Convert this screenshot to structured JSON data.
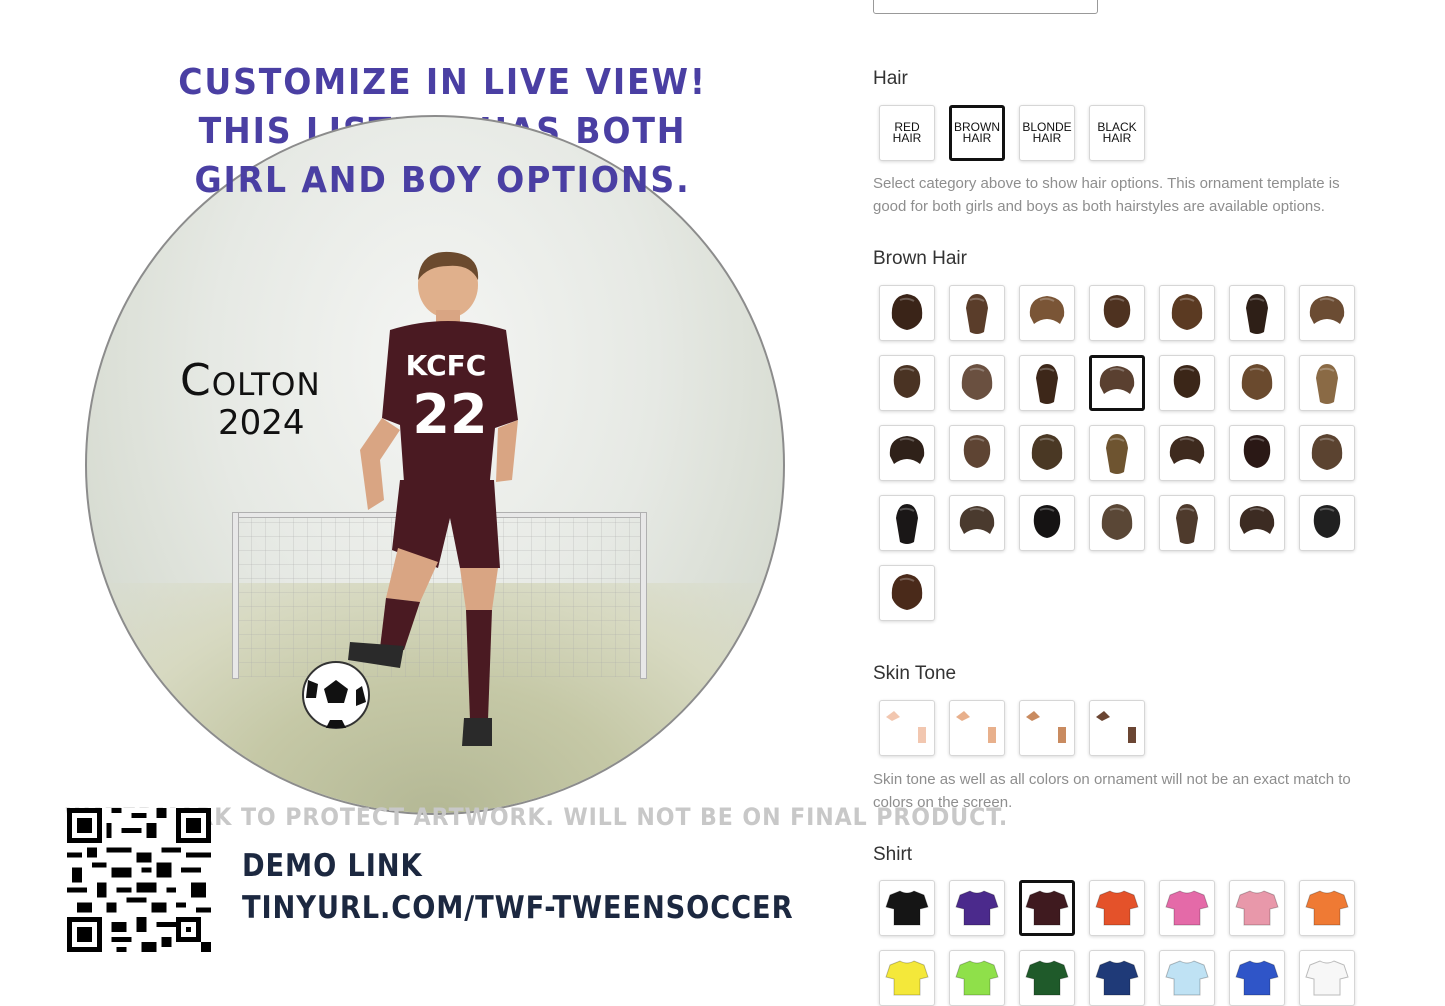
{
  "preview": {
    "headline_lines": [
      "CUSTOMIZE IN LIVE VIEW!",
      "THIS LISTING HAS BOTH",
      "GIRL AND BOY OPTIONS."
    ],
    "player_name": "Colton",
    "player_year": "2024",
    "jersey_team": "KCFC",
    "jersey_number": "22",
    "jersey_color": "#4a1a22",
    "watermark": "WATERMARK TO PROTECT ARTWORK. WILL NOT BE ON FINAL PRODUCT.",
    "demo_title": "DEMO LINK",
    "demo_url": "TINYURL.COM/TWF-TWEENSOCCER"
  },
  "panel": {
    "hair": {
      "title": "Hair",
      "categories": [
        {
          "line1": "RED",
          "line2": "HAIR",
          "selected": false
        },
        {
          "line1": "BROWN",
          "line2": "HAIR",
          "selected": true
        },
        {
          "line1": "BLONDE",
          "line2": "HAIR",
          "selected": false
        },
        {
          "line1": "BLACK",
          "line2": "HAIR",
          "selected": false
        }
      ],
      "help": "Select category above to show hair options.  This ornament template is good for both girls and boys as both hairstyles are available options."
    },
    "brown_hair": {
      "title": "Brown Hair",
      "selected_index": 10,
      "colors": [
        "#3a2418",
        "#5a3d2a",
        "#7a5536",
        "#4e3220",
        "#5b3a22",
        "#2e1f17",
        "#6b4c33",
        "#4a3323",
        "#6a5040",
        "#3d2719",
        "#5a4030",
        "#3b2618",
        "#6a4a2e",
        "#8a6a45",
        "#2f2119",
        "#5e4433",
        "#4a3824",
        "#6e5430",
        "#3e2a1e",
        "#2a1815",
        "#5b4330",
        "#1a1717",
        "#4a3a2e",
        "#151313",
        "#5a4736",
        "#4e3a2c",
        "#3c2b22",
        "#202020",
        "#4a2a1a"
      ]
    },
    "skin": {
      "title": "Skin Tone",
      "tones": [
        "#f2c7b0",
        "#e8b08c",
        "#c98b60",
        "#6b4633"
      ],
      "help": "Skin tone as well as all colors on ornament will not be an exact match to colors on the screen."
    },
    "shirt": {
      "title": "Shirt",
      "selected_index": 2,
      "colors": [
        "#151515",
        "#4b2a8c",
        "#3f1a1f",
        "#e4522a",
        "#e46aa8",
        "#e898aa",
        "#ef7a34",
        "#f4e83a",
        "#8fe04a",
        "#1f5a2a",
        "#1f3a78",
        "#bfe2f4",
        "#2f55c8",
        "#f7f7f7"
      ]
    }
  }
}
